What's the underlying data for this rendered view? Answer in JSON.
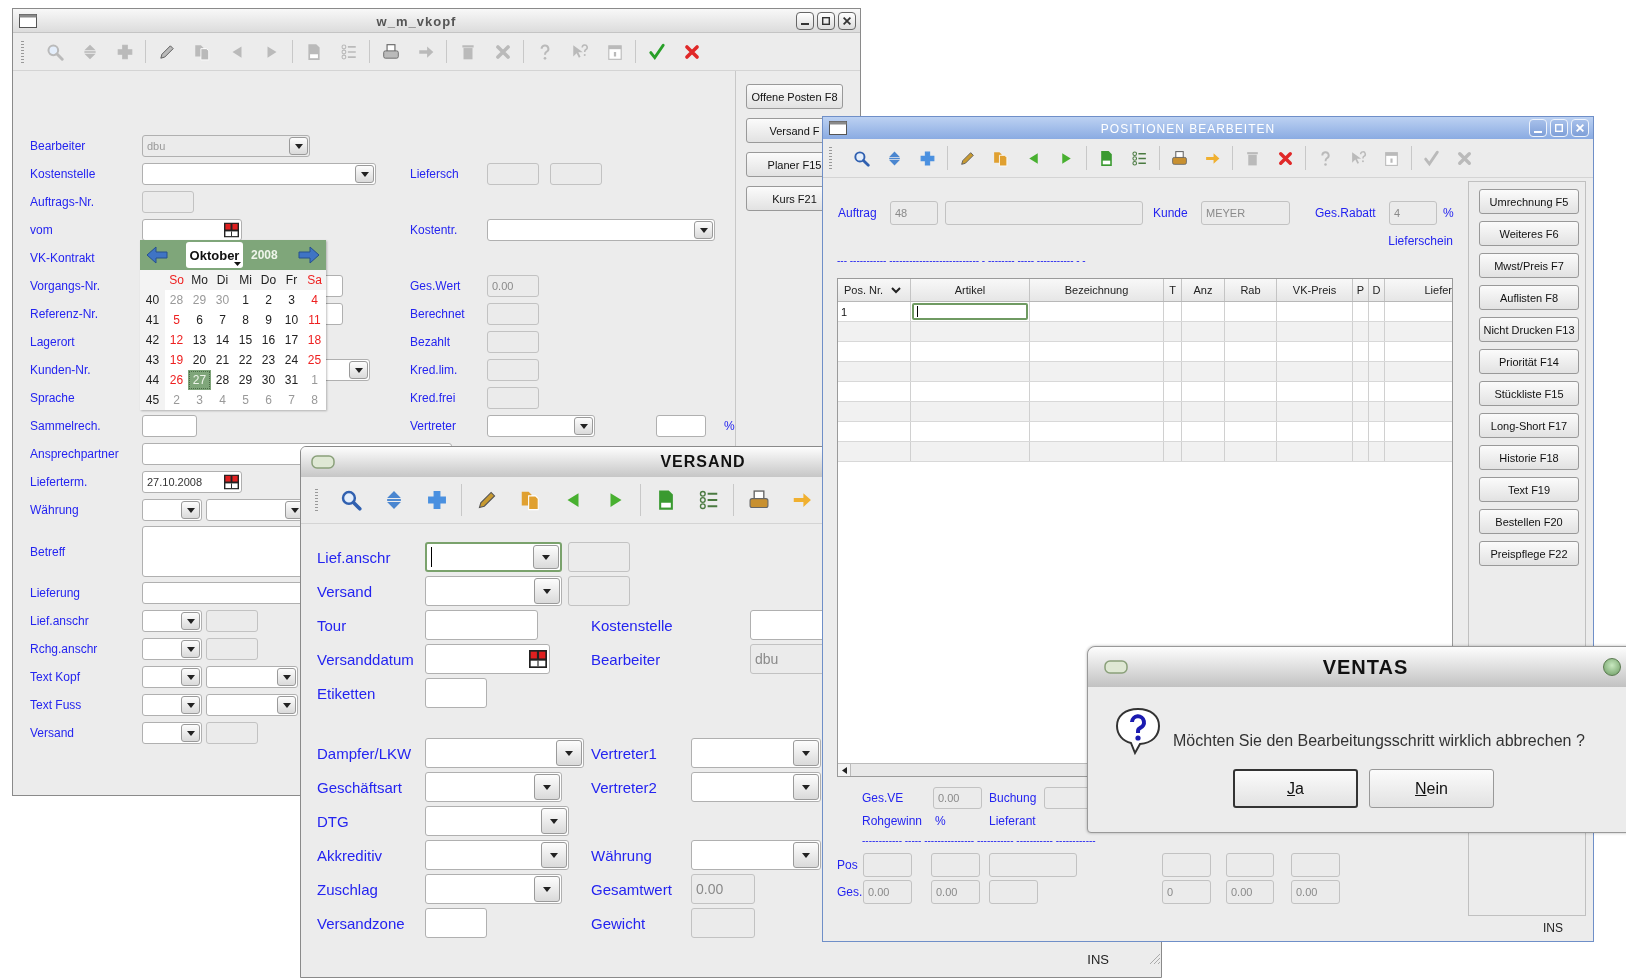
{
  "main_window": {
    "title": "w_m_vkopf",
    "toolbar": [
      {
        "disabled": true
      },
      {
        "disabled": true
      },
      {
        "disabled": true
      },
      {
        "disabled": true
      },
      {
        "disabled": true
      },
      {
        "disabled": true
      },
      {
        "disabled": true
      },
      {
        "disabled": true
      },
      {
        "disabled": true
      },
      {
        "disabled": true
      },
      {
        "disabled": true
      },
      {
        "disabled": true
      },
      {
        "disabled": true
      },
      {
        "disabled": true
      },
      {
        "disabled": true
      },
      {
        "disabled": true
      },
      {
        "disabled": false
      },
      {
        "disabled": false
      }
    ],
    "form_rows": [
      {
        "label": "Bearbeiter",
        "fields": [
          {
            "kind": "lockedcombo",
            "value": "dbu"
          }
        ]
      },
      {
        "label": "Kostenstelle",
        "fields": [
          {
            "kind": "combo"
          }
        ],
        "right_label": "Liefersch",
        "right_fields": [
          {
            "kind": "box"
          },
          {
            "kind": "box"
          }
        ]
      },
      {
        "label": "Auftrags-Nr.",
        "fields": [
          {
            "kind": "box"
          }
        ]
      },
      {
        "label": "vom",
        "fields": [
          {
            "kind": "date"
          }
        ],
        "right_label": "Kostentr.",
        "right_fields": [
          {
            "kind": "combo"
          }
        ]
      },
      {
        "label": "VK-Kontrakt"
      },
      {
        "label": "Vorgangs-Nr.",
        "fields": [
          {
            "kind": "entry"
          }
        ],
        "right_label": "Ges.Wert",
        "right_fields": [
          {
            "kind": "box",
            "value": "0.00"
          }
        ]
      },
      {
        "label": "Referenz-Nr.",
        "fields": [
          {
            "kind": "entry"
          }
        ],
        "right_label": "Berechnet",
        "right_fields": [
          {
            "kind": "box"
          }
        ]
      },
      {
        "label": "Lagerort",
        "right_label": "Bezahlt",
        "right_fields": [
          {
            "kind": "box"
          }
        ]
      },
      {
        "label": "Kunden-Nr.",
        "fields": [
          {
            "kind": "combo"
          }
        ],
        "right_label": "Kred.lim.",
        "right_fields": [
          {
            "kind": "box"
          }
        ]
      },
      {
        "label": "Sprache",
        "right_label": "Kred.frei",
        "right_fields": [
          {
            "kind": "box"
          }
        ]
      },
      {
        "label": "Sammelrech.",
        "fields": [
          {
            "kind": "entry"
          }
        ],
        "right_label": "Vertreter",
        "right_fields": [
          {
            "kind": "combo"
          },
          {
            "kind": "entry"
          }
        ],
        "right_suffix": "%"
      },
      {
        "label": "Ansprechpartner",
        "fields": [
          {
            "kind": "entry"
          }
        ]
      },
      {
        "label": "Lieferterm.",
        "fields": [
          {
            "kind": "date",
            "value": "27.10.2008"
          }
        ]
      },
      {
        "label": "Währung",
        "fields": [
          {
            "kind": "combo"
          },
          {
            "kind": "combo"
          }
        ]
      },
      {
        "label": "Betreff",
        "fields": [
          {
            "kind": "area"
          }
        ]
      },
      {
        "label": "Lieferung",
        "fields": [
          {
            "kind": "entry"
          }
        ]
      },
      {
        "label": "Lief.anschr",
        "fields": [
          {
            "kind": "combo"
          },
          {
            "kind": "box"
          }
        ]
      },
      {
        "label": "Rchg.anschr",
        "fields": [
          {
            "kind": "combo"
          },
          {
            "kind": "box"
          }
        ]
      },
      {
        "label": "Text Kopf",
        "fields": [
          {
            "kind": "combo"
          },
          {
            "kind": "combo"
          }
        ]
      },
      {
        "label": "Text Fuss",
        "fields": [
          {
            "kind": "combo"
          },
          {
            "kind": "combo"
          }
        ]
      },
      {
        "label": "Versand",
        "fields": [
          {
            "kind": "combo"
          },
          {
            "kind": "box"
          }
        ]
      }
    ],
    "calendar": {
      "month": "Oktober",
      "year": "2008",
      "weekdays": [
        {
          "label": "So",
          "weekend": true
        },
        {
          "label": "Mo",
          "weekend": false
        },
        {
          "label": "Di",
          "weekend": false
        },
        {
          "label": "Mi",
          "weekend": false
        },
        {
          "label": "Do",
          "weekend": false
        },
        {
          "label": "Fr",
          "weekend": false
        },
        {
          "label": "Sa",
          "weekend": true
        }
      ],
      "weeks": [
        {
          "number": "40",
          "days": [
            {
              "day": "28",
              "outside": true,
              "selected": false
            },
            {
              "day": "29",
              "outside": true,
              "selected": false
            },
            {
              "day": "30",
              "outside": true,
              "selected": false
            },
            {
              "day": "1",
              "outside": false,
              "selected": false
            },
            {
              "day": "2",
              "outside": false,
              "selected": false
            },
            {
              "day": "3",
              "outside": false,
              "selected": false
            },
            {
              "day": "4",
              "outside": false,
              "selected": false
            }
          ]
        },
        {
          "number": "41",
          "days": [
            {
              "day": "5",
              "outside": false,
              "selected": false
            },
            {
              "day": "6",
              "outside": false,
              "selected": false
            },
            {
              "day": "7",
              "outside": false,
              "selected": false
            },
            {
              "day": "8",
              "outside": false,
              "selected": false
            },
            {
              "day": "9",
              "outside": false,
              "selected": false
            },
            {
              "day": "10",
              "outside": false,
              "selected": false
            },
            {
              "day": "11",
              "outside": false,
              "selected": false
            }
          ]
        },
        {
          "number": "42",
          "days": [
            {
              "day": "12",
              "outside": false,
              "selected": false
            },
            {
              "day": "13",
              "outside": false,
              "selected": false
            },
            {
              "day": "14",
              "outside": false,
              "selected": false
            },
            {
              "day": "15",
              "outside": false,
              "selected": false
            },
            {
              "day": "16",
              "outside": false,
              "selected": false
            },
            {
              "day": "17",
              "outside": false,
              "selected": false
            },
            {
              "day": "18",
              "outside": false,
              "selected": false
            }
          ]
        },
        {
          "number": "43",
          "days": [
            {
              "day": "19",
              "outside": false,
              "selected": false
            },
            {
              "day": "20",
              "outside": false,
              "selected": false
            },
            {
              "day": "21",
              "outside": false,
              "selected": false
            },
            {
              "day": "22",
              "outside": false,
              "selected": false
            },
            {
              "day": "23",
              "outside": false,
              "selected": false
            },
            {
              "day": "24",
              "outside": false,
              "selected": false
            },
            {
              "day": "25",
              "outside": false,
              "selected": false
            }
          ]
        },
        {
          "number": "44",
          "days": [
            {
              "day": "26",
              "outside": false,
              "selected": false
            },
            {
              "day": "27",
              "outside": false,
              "selected": true
            },
            {
              "day": "28",
              "outside": false,
              "selected": false
            },
            {
              "day": "29",
              "outside": false,
              "selected": false
            },
            {
              "day": "30",
              "outside": false,
              "selected": false
            },
            {
              "day": "31",
              "outside": false,
              "selected": false
            },
            {
              "day": "1",
              "outside": true,
              "selected": false
            }
          ]
        },
        {
          "number": "45",
          "days": [
            {
              "day": "2",
              "outside": true,
              "selected": false
            },
            {
              "day": "3",
              "outside": true,
              "selected": false
            },
            {
              "day": "4",
              "outside": true,
              "selected": false
            },
            {
              "day": "5",
              "outside": true,
              "selected": false
            },
            {
              "day": "6",
              "outside": true,
              "selected": false
            },
            {
              "day": "7",
              "outside": true,
              "selected": false
            },
            {
              "day": "8",
              "outside": true,
              "selected": false
            }
          ]
        }
      ]
    },
    "side_buttons": [
      "Offene Posten F8",
      "Versand F",
      "Planer F15",
      "Kurs F21"
    ]
  },
  "versand_window": {
    "title": "VERSAND",
    "toolbar": [
      {
        "disabled": false
      },
      {
        "disabled": false
      },
      {
        "disabled": false
      },
      {
        "disabled": false
      },
      {
        "disabled": false
      },
      {
        "disabled": false
      },
      {
        "disabled": false
      },
      {
        "disabled": false
      },
      {
        "disabled": false
      },
      {
        "disabled": false
      },
      {
        "disabled": false
      }
    ],
    "form_rows": [
      {
        "label": "Lief.anschr",
        "fields": [
          {
            "kind": "combo",
            "focused": true
          },
          {
            "kind": "box"
          }
        ]
      },
      {
        "label": "Versand",
        "fields": [
          {
            "kind": "combo"
          },
          {
            "kind": "box"
          }
        ]
      },
      {
        "label": "Tour",
        "fields": [
          {
            "kind": "entry"
          }
        ],
        "right_label": "Kostenstelle",
        "right_fields": [
          {
            "kind": "entry"
          }
        ]
      },
      {
        "label": "Versanddatum",
        "fields": [
          {
            "kind": "date"
          }
        ],
        "right_label": "Bearbeiter",
        "right_fields": [
          {
            "kind": "box",
            "value": "dbu"
          }
        ]
      },
      {
        "label": "Etiketten",
        "fields": [
          {
            "kind": "entry"
          }
        ]
      },
      {
        "label": "Dampfer/LKW",
        "fields": [
          {
            "kind": "combo"
          }
        ],
        "right_label": "Vertreter1",
        "right_fields": [
          {
            "kind": "combo"
          }
        ]
      },
      {
        "label": "Geschäftsart",
        "fields": [
          {
            "kind": "combo"
          }
        ],
        "right_label": "Vertreter2",
        "right_fields": [
          {
            "kind": "combo"
          }
        ]
      },
      {
        "label": "DTG",
        "fields": [
          {
            "kind": "combo"
          }
        ]
      },
      {
        "label": "Akkreditiv",
        "fields": [
          {
            "kind": "combo"
          }
        ],
        "right_label": "Währung",
        "right_fields": [
          {
            "kind": "combo"
          }
        ]
      },
      {
        "label": "Zuschlag",
        "fields": [
          {
            "kind": "combo"
          }
        ],
        "right_label": "Gesamtwert",
        "right_fields": [
          {
            "kind": "box",
            "value": "0.00"
          }
        ]
      },
      {
        "label": "Versandzone",
        "fields": [
          {
            "kind": "entry"
          }
        ],
        "right_label": "Gewicht",
        "right_fields": [
          {
            "kind": "box"
          }
        ]
      }
    ],
    "status": "INS"
  },
  "positionen_window": {
    "title": "POSITIONEN BEARBEITEN",
    "toolbar": [
      {
        "disabled": false
      },
      {
        "disabled": false
      },
      {
        "disabled": false
      },
      {
        "disabled": false
      },
      {
        "disabled": false
      },
      {
        "disabled": false
      },
      {
        "disabled": false
      },
      {
        "disabled": false
      },
      {
        "disabled": false
      },
      {
        "disabled": false
      },
      {
        "disabled": false
      },
      {
        "disabled": true
      },
      {
        "disabled": false
      },
      {
        "disabled": true
      },
      {
        "disabled": true
      },
      {
        "disabled": true
      },
      {
        "disabled": true
      },
      {
        "disabled": true
      }
    ],
    "header": {
      "auftrag_label": "Auftrag",
      "auftrag": "48",
      "kunde_label": "Kunde",
      "kunde": "MEYER",
      "rabatt_label": "Ges.Rabatt",
      "rabatt": "4",
      "rabatt_unit": "%",
      "lieferschein": "Lieferschein",
      "dashes": "--- ----------- --------------------------- - -------- ----- ----------- - -"
    },
    "table": {
      "columns": [
        {
          "label": "Pos. Nr.",
          "sorted": true
        },
        {
          "label": "Artikel",
          "sorted": false
        },
        {
          "label": "Bezeichnung",
          "sorted": false
        },
        {
          "label": "T",
          "sorted": false
        },
        {
          "label": "Anz",
          "sorted": false
        },
        {
          "label": "Rab",
          "sorted": false
        },
        {
          "label": "VK-Preis",
          "sorted": false
        },
        {
          "label": "P",
          "sorted": false
        },
        {
          "label": "D",
          "sorted": false
        },
        {
          "label": "Liefer",
          "sorted": false
        }
      ],
      "rows": [
        {
          "pos_nr": "1",
          "editing": true
        }
      ]
    },
    "summary": {
      "ges_ve_label": "Ges.VE",
      "ges_ve": "0.00",
      "buchung_label": "Buchung",
      "rohgewinn_label": "Rohgewinn",
      "rohgewinn_unit": "%",
      "lieferant_label": "Lieferant",
      "dashes": "------------ ----- --------------- ----------- ----------- ------------",
      "pos_label": "Pos",
      "ges_label": "Ges.",
      "ges_values": [
        "0.00",
        "0.00",
        "0",
        "0.00",
        "0.00"
      ]
    },
    "side_buttons": [
      "Umrechnung F5",
      "Weiteres F6",
      "Mwst/Preis F7",
      "Auflisten F8",
      "Nicht Drucken F13",
      "Priorität F14",
      "Stückliste F15",
      "Long-Short F17",
      "Historie F18",
      "Text F19",
      "Bestellen F20",
      "Preispflege F22"
    ],
    "status": "INS"
  },
  "confirm_dialog": {
    "title": "VENTAS",
    "message": "Möchten Sie den Bearbeitungsschritt wirklich abbrechen ?",
    "buttons": [
      {
        "label": "Ja",
        "default": true
      },
      {
        "label": "Nein",
        "default": false
      }
    ]
  }
}
